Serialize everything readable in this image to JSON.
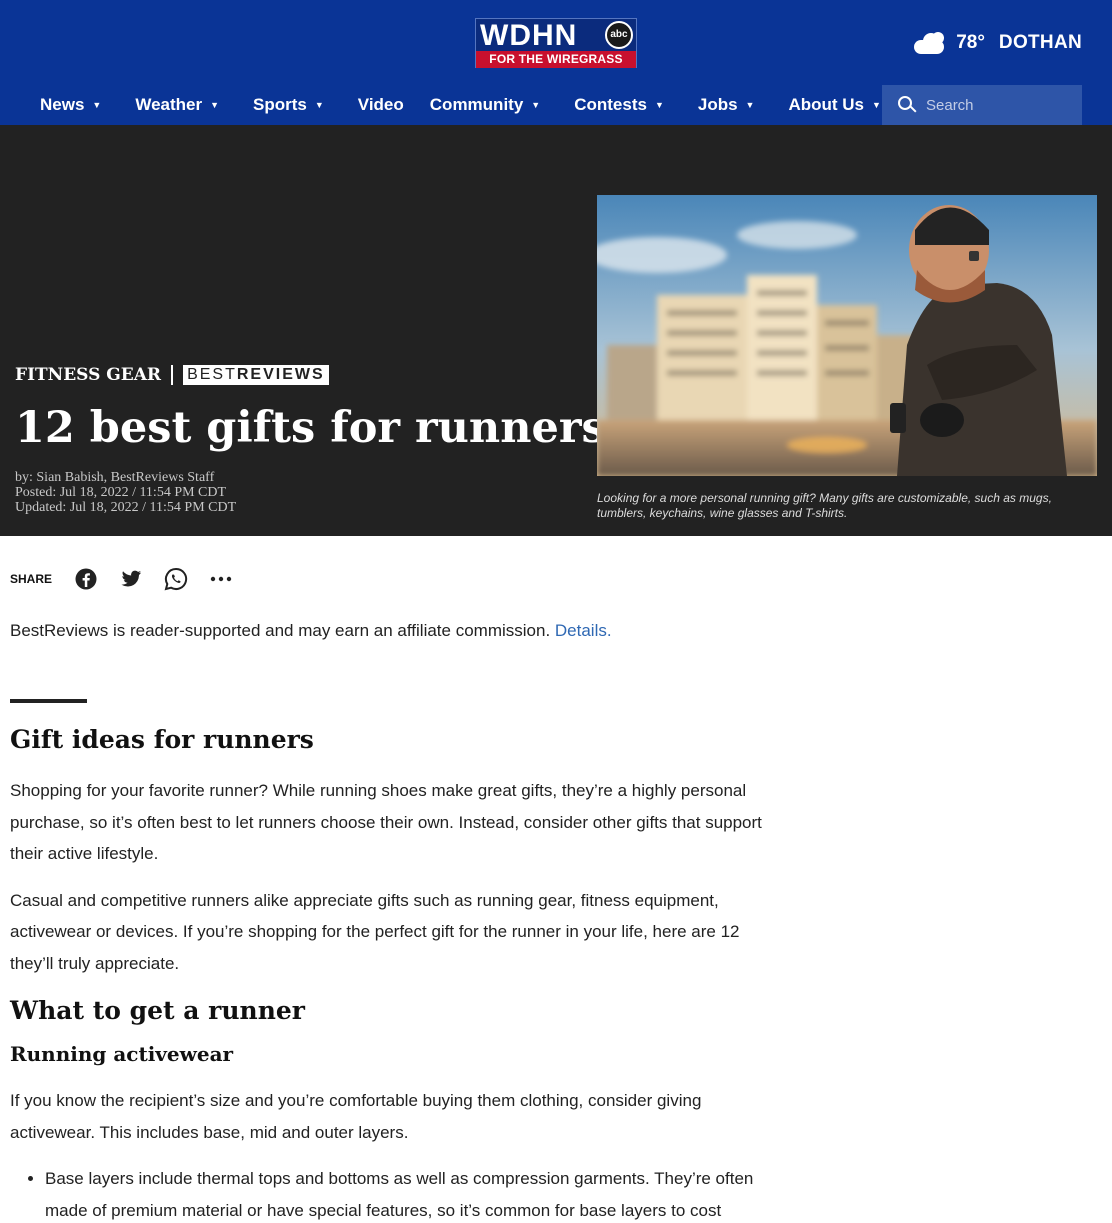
{
  "header": {
    "logo_main": "WDHN",
    "logo_network": "abc",
    "logo_tagline": "FOR THE WIREGRASS",
    "weather_icon": "partly-cloudy-icon",
    "temperature": "78°",
    "city": "DOTHAN",
    "search_placeholder": "Search"
  },
  "nav": {
    "items": [
      {
        "label": "News",
        "caret": "▼"
      },
      {
        "label": "Weather",
        "caret": "▼"
      },
      {
        "label": "Sports",
        "caret": "▼"
      },
      {
        "label": "Video",
        "caret": ""
      },
      {
        "label": "Community",
        "caret": "▼"
      },
      {
        "label": "Contests",
        "caret": "▼"
      },
      {
        "label": "Jobs",
        "caret": "▼"
      },
      {
        "label": "About Us",
        "caret": "▼"
      }
    ]
  },
  "hero": {
    "category": "FITNESS GEAR",
    "partner_logo_a": "BEST",
    "partner_logo_b": "REVIEWS",
    "title": "12 best gifts for runners",
    "byline": "by: Sian Babish, BestReviews Staff",
    "posted": "Posted: Jul 18, 2022 / 11:54 PM CDT",
    "updated": "Updated: Jul 18, 2022 / 11:54 PM CDT",
    "caption": "Looking for a more personal running gift? Many gifts are customizable, such as mugs, tumblers, keychains, wine glasses and T-shirts."
  },
  "share": {
    "label": "SHARE",
    "icons": [
      "facebook-icon",
      "twitter-icon",
      "whatsapp-icon",
      "more-icon"
    ]
  },
  "disclaimer": {
    "text": "BestReviews is reader-supported and may earn an affiliate commission. ",
    "link": "Details."
  },
  "article": {
    "h2_1": "Gift ideas for runners",
    "p1": "Shopping for your favorite runner? While running shoes make great gifts, they’re a highly personal purchase, so it’s often best to let runners choose their own. Instead, consider other gifts that support their active lifestyle.",
    "p2": "Casual and competitive runners alike appreciate gifts such as running gear, fitness equipment, activewear or devices. If you’re shopping for the perfect gift for the runner in your life, here are 12 they’ll truly appreciate.",
    "h2_2": "What to get a runner",
    "h3_1": "Running activewear",
    "p3": "If you know the recipient’s size and you’re comfortable buying them clothing, consider giving activewear. This includes base, mid and outer layers.",
    "li1": "Base layers include thermal tops and bottoms as well as compression garments. They’re often made of premium material or have special features, so it’s common for base layers to cost more"
  }
}
